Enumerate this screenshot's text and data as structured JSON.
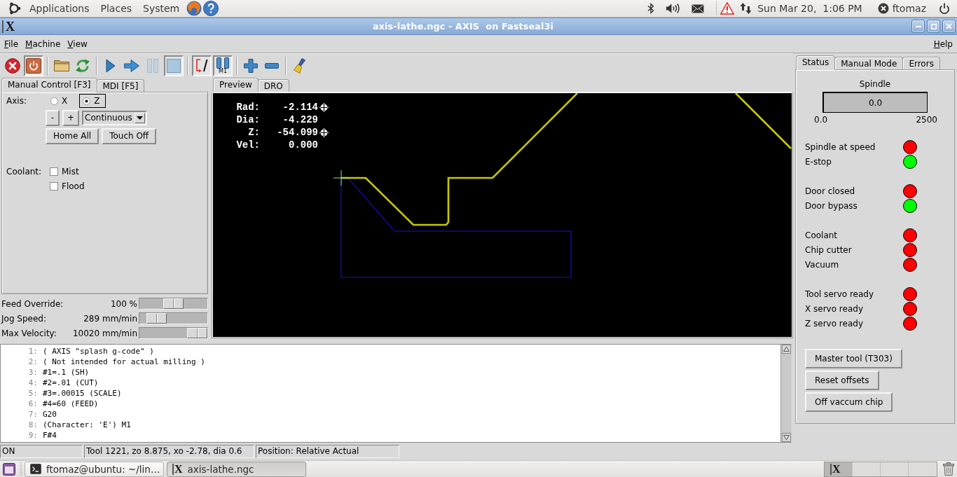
{
  "top_panel": {
    "menus": [
      "Applications",
      "Places",
      "System"
    ],
    "clock": "Sun Mar 20,  1:06 PM",
    "user": "ftomaz"
  },
  "window": {
    "icon": "X",
    "title": "axis-lathe.ngc - AXIS  on Fastseal3i"
  },
  "menu_bar": {
    "items": [
      "File",
      "Machine",
      "View"
    ],
    "help": "Help"
  },
  "toolbar": {
    "groups": [
      [
        {
          "kind": "estop",
          "pressed": false,
          "disabled": false
        },
        {
          "kind": "power",
          "pressed": true,
          "disabled": false
        }
      ],
      [
        {
          "kind": "open",
          "pressed": false,
          "disabled": false
        },
        {
          "kind": "reload",
          "pressed": false,
          "disabled": false
        }
      ],
      [
        {
          "kind": "run",
          "pressed": false,
          "disabled": false
        },
        {
          "kind": "step",
          "pressed": false,
          "disabled": false
        },
        {
          "kind": "pause",
          "pressed": false,
          "disabled": true
        },
        {
          "kind": "stop",
          "pressed": true,
          "disabled": false
        }
      ],
      [
        {
          "kind": "block_delete",
          "pressed": true,
          "disabled": false
        },
        {
          "kind": "optional_stop",
          "pressed": true,
          "disabled": false,
          "label": "M1"
        }
      ],
      [
        {
          "kind": "zoom_in",
          "pressed": false,
          "disabled": false
        },
        {
          "kind": "zoom_out",
          "pressed": false,
          "disabled": false
        }
      ],
      [
        {
          "kind": "clear",
          "pressed": false,
          "disabled": false
        }
      ]
    ]
  },
  "manual_control": {
    "tabs": [
      {
        "label": "Manual Control [F3]",
        "selected": true
      },
      {
        "label": "MDI [F5]",
        "selected": false
      }
    ],
    "axis_label": "Axis:",
    "axes": [
      {
        "label": "X",
        "selected": false
      },
      {
        "label": "Z",
        "selected": true
      }
    ],
    "jog_buttons": [
      "-",
      "+"
    ],
    "jog_increment": "Continuous",
    "buttons": [
      "Home All",
      "Touch Off"
    ],
    "coolant_label": "Coolant:",
    "coolant": [
      {
        "label": "Mist",
        "checked": false
      },
      {
        "label": "Flood",
        "checked": false
      }
    ]
  },
  "overrides": [
    {
      "label": "Feed Override:",
      "reading": "100 %",
      "level": 0.5
    },
    {
      "label": "Jog Speed:",
      "reading": "289 mm/min",
      "level": 0.14
    },
    {
      "label": "Max Velocity:",
      "reading": "10020 mm/min",
      "level": 1
    }
  ],
  "preview": {
    "tabs": [
      {
        "label": "Preview",
        "selected": true
      },
      {
        "label": "DRO",
        "selected": false
      }
    ],
    "dro": [
      {
        "label": "Rad:",
        "value": "-2.114",
        "homed": true
      },
      {
        "label": "Dia:",
        "value": "-4.229",
        "homed": false
      },
      {
        "label": "Z:",
        "value": "-54.099",
        "homed": true
      },
      {
        "label": "Vel:",
        "value": "0.000",
        "homed": false
      }
    ]
  },
  "gcode": [
    {
      "number": "1:",
      "text": "( AXIS \"splash g-code\" )"
    },
    {
      "number": "2:",
      "text": "( Not intended for actual milling )"
    },
    {
      "number": "3:",
      "text": "#1=.1 (SH)"
    },
    {
      "number": "4:",
      "text": "#2=.01 (CUT)"
    },
    {
      "number": "5:",
      "text": "#3=.00015 (SCALE)"
    },
    {
      "number": "6:",
      "text": "#4=60 (FEED)"
    },
    {
      "number": "7:",
      "text": "G20"
    },
    {
      "number": "8:",
      "text": "(Character: 'E') M1"
    },
    {
      "number": "9:",
      "text": "F#4"
    }
  ],
  "status_bar": [
    "ON",
    "Tool 1221, zo 8.875, xo -2.78, dia 0.6",
    "Position: Relative Actual"
  ],
  "side_panel": {
    "tabs": [
      {
        "label": "Status",
        "selected": true
      },
      {
        "label": "Manual Mode",
        "selected": false
      },
      {
        "label": "Errors",
        "selected": false
      }
    ],
    "spindle": {
      "label": "Spindle",
      "reading": "0.0",
      "min": "0.0",
      "max": "2500"
    },
    "indicator_groups": [
      [
        {
          "label": "Spindle at speed",
          "color": "#ff0000"
        },
        {
          "label": "E-stop",
          "color": "#00ff00"
        }
      ],
      [
        {
          "label": "Door closed",
          "color": "#ff0000"
        },
        {
          "label": "Door bypass",
          "color": "#00ff00"
        }
      ],
      [
        {
          "label": "Coolant",
          "color": "#ff0000"
        },
        {
          "label": "Chip cutter",
          "color": "#ff0000"
        },
        {
          "label": "Vacuum",
          "color": "#ff0000"
        }
      ],
      [
        {
          "label": "Tool servo ready",
          "color": "#ff0000"
        },
        {
          "label": "X servo ready",
          "color": "#ff0000"
        },
        {
          "label": "Z servo ready",
          "color": "#ff0000"
        }
      ]
    ],
    "buttons": [
      "Master tool (T303)",
      "Reset offsets",
      "Off vaccum chip"
    ]
  },
  "taskbar": {
    "tasks": [
      {
        "kind": "terminal",
        "label": "ftomaz@ubuntu: ~/lin…",
        "selected": false
      },
      {
        "kind": "axis",
        "icon": "X",
        "label": "axis-lathe.ngc",
        "selected": true
      }
    ],
    "workspaces": [
      {
        "selected": true,
        "icon": "X"
      },
      {
        "selected": false
      },
      {
        "selected": false
      },
      {
        "selected": false
      }
    ]
  }
}
